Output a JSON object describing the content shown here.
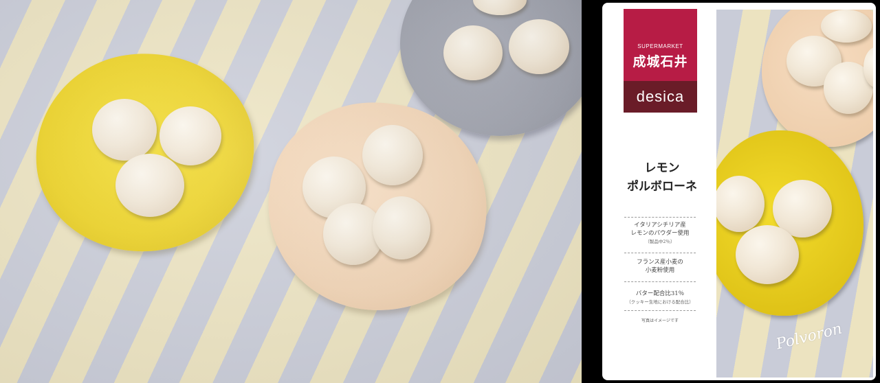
{
  "package": {
    "brand_small": "SUPERMARKET",
    "brand_main": "成城石井",
    "brand_sub": "desica",
    "title_line1": "レモン",
    "title_line2": "ポルボローネ",
    "features": [
      {
        "line1": "イタリアシチリア産",
        "line2": "レモンのパウダー使用",
        "small": "（製品中2％）"
      },
      {
        "line1": "フランス産小麦の",
        "line2": "小麦粉使用",
        "small": ""
      },
      {
        "line1": "バター配合比31％",
        "line2": "",
        "small": "（クッキー生地における配合比）"
      }
    ],
    "note": "写真はイメージです",
    "script": "Polvoron"
  },
  "colors": {
    "brand_red": "#b71c45",
    "brand_dark": "#6a1c28",
    "plate_yellow": "#ecd11e",
    "plate_peach": "#f0d2b2",
    "plate_gray": "#9c9faa"
  }
}
